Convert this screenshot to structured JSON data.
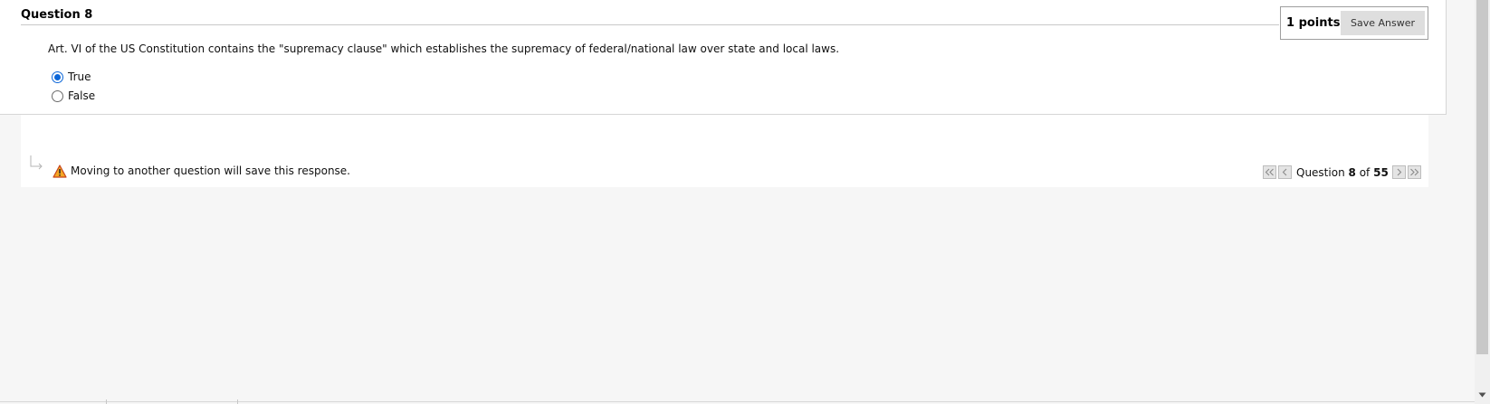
{
  "question": {
    "title": "Question 8",
    "points": "1 points",
    "save_label": "Save Answer",
    "text": "Art. VI of the US Constitution contains the \"supremacy clause\" which establishes the supremacy of federal/national law over state and local laws.",
    "options": [
      {
        "label": "True",
        "selected": true
      },
      {
        "label": "False",
        "selected": false
      }
    ]
  },
  "footer": {
    "warning": "Moving to another question will save this response.",
    "nav": {
      "prefix": "Question",
      "current": "8",
      "of": "of",
      "total": "55"
    }
  },
  "icons": {
    "warning": "warning-icon",
    "first": "double-chevron-left-icon",
    "prev": "chevron-left-icon",
    "next": "chevron-right-icon",
    "last": "double-chevron-right-icon"
  },
  "colors": {
    "radio_accent": "#0b66d8",
    "warning_fill": "#f5a623"
  }
}
